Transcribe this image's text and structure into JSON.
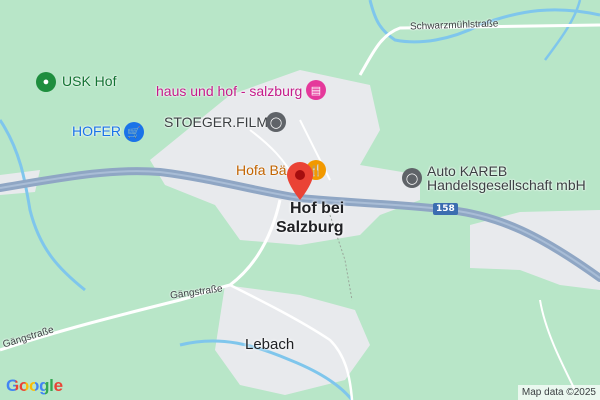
{
  "map": {
    "places": {
      "usk_hof": "USK Hof",
      "hofer": "HOFER",
      "haus_und_hof": "haus und hof - salzburg",
      "stoeger_film": "STOEGER.FILM",
      "hofa": "Hofa Bä",
      "auto_kareb_line1": "Auto KAREB",
      "auto_kareb_line2": "Handelsgesellschaft mbH"
    },
    "localities": {
      "hof_line1": "Hof bei",
      "hof_line2": "Salzburg",
      "lebach": "Lebach"
    },
    "roads": {
      "schwarzmuhl": "Schwarzmühlstraße",
      "gangstrasse_a": "Gängstraße",
      "gangstrasse_b": "Gängstraße",
      "route_shield": "158"
    },
    "logo": "Google",
    "attribution": "Map data ©2025",
    "colors": {
      "forest": "#b8e6c8",
      "built_area": "#e8eaed",
      "water": "#7fc6ec",
      "highway": "#8fa6c4",
      "marker": "#ea4335"
    }
  }
}
